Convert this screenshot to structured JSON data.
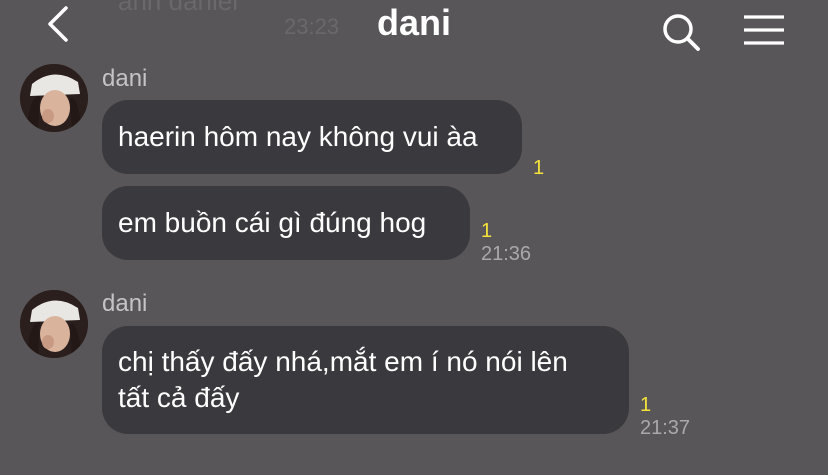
{
  "header": {
    "title": "dani",
    "back_icon": "chevron-left-icon",
    "search_icon": "search-icon",
    "menu_icon": "hamburger-menu-icon",
    "ghost_name": "anh daniel",
    "ghost_time": "23:23"
  },
  "colors": {
    "background": "#585659",
    "bubble": "#3a393d",
    "unread": "#f5e33a",
    "timestamp": "#a9a8ab"
  },
  "messages": [
    {
      "sender": "dani",
      "bubbles": [
        {
          "text": "haerin hôm nay không vui àa",
          "unread": "1",
          "time": ""
        },
        {
          "text": "em buồn cái gì đúng hog",
          "unread": "1",
          "time": "21:36"
        }
      ]
    },
    {
      "sender": "dani",
      "bubbles": [
        {
          "line1": "chị thấy đấy nhá,mắt em í nó nói lên",
          "line2": "tất cả đấy",
          "unread": "1",
          "time": "21:37"
        }
      ]
    }
  ]
}
